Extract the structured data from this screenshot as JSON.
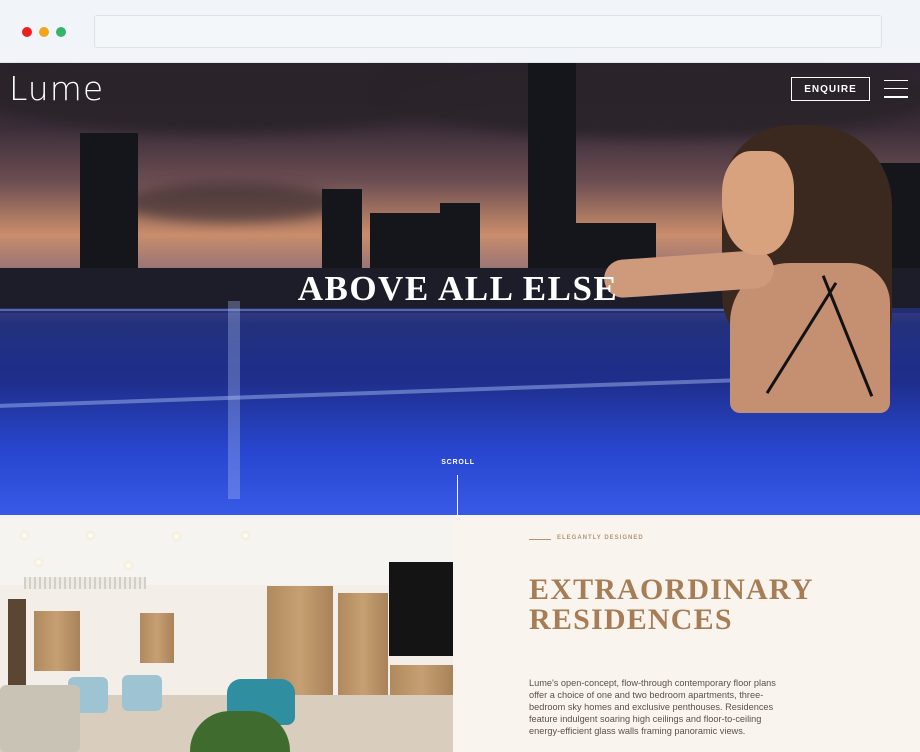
{
  "browser": {
    "window_controls": [
      "close",
      "minimize",
      "maximize"
    ],
    "address_value": ""
  },
  "header": {
    "logo_text": "Lume",
    "enquire_label": "ENQUIRE",
    "menu_icon": "hamburger-menu-icon"
  },
  "hero": {
    "headline": "ABOVE ALL ELSE",
    "scroll_label": "SCROLL"
  },
  "residences": {
    "eyebrow": "ELEGANTLY DESIGNED",
    "title_line1": "EXTRAORDINARY",
    "title_line2": "RESIDENCES",
    "body": "Lume's open-concept, flow-through contemporary floor plans offer a choice of one and two bedroom apartments, three-bedroom sky homes and exclusive penthouses. Residences feature indulgent soaring high ceilings and floor-to-ceiling energy-efficient glass walls framing panoramic views."
  },
  "colors": {
    "accent_gold": "#a77d56",
    "eyebrow_tan": "#b39476",
    "section_bg": "#f9f5ee",
    "pool_blue": "#2d4ecb"
  }
}
